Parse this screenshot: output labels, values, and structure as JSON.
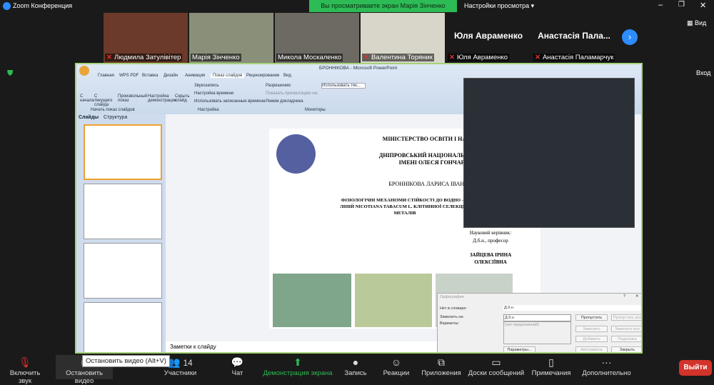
{
  "app": {
    "title": "Zoom Конференция",
    "banner": "Вы просматриваете экран Марія Зінченко",
    "view_options": "Настройки просмотра",
    "view_button": "Вид",
    "enter_label": "Вход"
  },
  "participants": [
    {
      "name": "Людмила Затулівітер"
    },
    {
      "name": "Марія Зінченко"
    },
    {
      "name": "Микола Москаленко"
    },
    {
      "name": "Валентина Торяник"
    },
    {
      "name": "Юля Авраменко",
      "display": "Юля Авраменко"
    },
    {
      "name": "Анастасія Паламарчук",
      "display": "Анастасія Пала..."
    }
  ],
  "ppt": {
    "title": "БРОННІКОВА - Microsoft PowerPoint",
    "tabs": [
      "Главная",
      "WPS PDF",
      "Вставка",
      "Дизайн",
      "Анимация",
      "Показ слайдов",
      "Рецензирование",
      "Вид"
    ],
    "ribbon": {
      "b1": "С начала",
      "b2": "С текущего слайда",
      "b3": "Произвольный показ",
      "g1": "Начать показ слайдов",
      "b4": "Настройка демонстрации",
      "b5": "Скрыть слайд",
      "o1": "Звукозапись",
      "o2": "Настройка времени",
      "o3": "Использовать записанные времена",
      "g2": "Настройка",
      "m1": "Разрешение:",
      "m2": "Показать презентацию на:",
      "m3": "Режим докладчика",
      "m_sel": "Использовать тек...",
      "g3": "Мониторы"
    },
    "panel_tabs": [
      "Слайды",
      "Структура"
    ],
    "notes": "Заметки к слайду",
    "slide": {
      "l1": "МІНІСТЕРСТВО ОСВІТИ І НАУКИ У",
      "l2": "ДНІПРОВСЬКИЙ НАЦІОНАЛЬНИЙ УН",
      "l3": "ІМЕНІ ОЛЕСЯ ГОНЧАРА",
      "author": "БРОННІКОВА ЛАРИСА ІВАНІВНА",
      "t1": "ФІЗІОЛОГІЧНІ МЕХАНІЗМИ СТІЙКОСТІ ДО ВОДНО – С",
      "t2": "ЛІНІЙ NICOTIANA TABACUM L. КЛІТИННОЇ СЕЛЕКЦІЇ З",
      "t3": "МЕТАЛІВ",
      "sup1": "Науковий керівник:",
      "sup2": "Д.б.н., професор",
      "sup3": "ЗАЙЦЕВА ІРИНА",
      "sup4": "ОЛЕКСІЇВНА"
    },
    "spell": {
      "title": "Орфография",
      "not_in_dict": "Нет в словаре:",
      "word": "Д.б.н",
      "replace": "Заменить на:",
      "replace_val": "Д.б.н",
      "variants": "Варианты:",
      "none": "(нет предложений)",
      "b_skip": "Пропустить",
      "b_skip_all": "Пропустить все",
      "b_change": "Заменить",
      "b_change_all": "Заменить все",
      "b_add": "Добавить",
      "b_suggest": "Подсказка",
      "b_options": "Параметры...",
      "b_autocorrect": "Автозамена",
      "b_close": "Закрыть"
    }
  },
  "toolbar": {
    "mute": "Включить звук",
    "video": "Остановить видео",
    "tooltip": "Остановить видео (Alt+V)",
    "participants": "Участники",
    "count": "14",
    "chat": "Чат",
    "share": "Демонстрация экрана",
    "record": "Запись",
    "reactions": "Реакции",
    "apps": "Приложения",
    "whiteboards": "Доски сообщений",
    "notes": "Примечания",
    "more": "Дополнительно",
    "leave": "Выйти"
  }
}
